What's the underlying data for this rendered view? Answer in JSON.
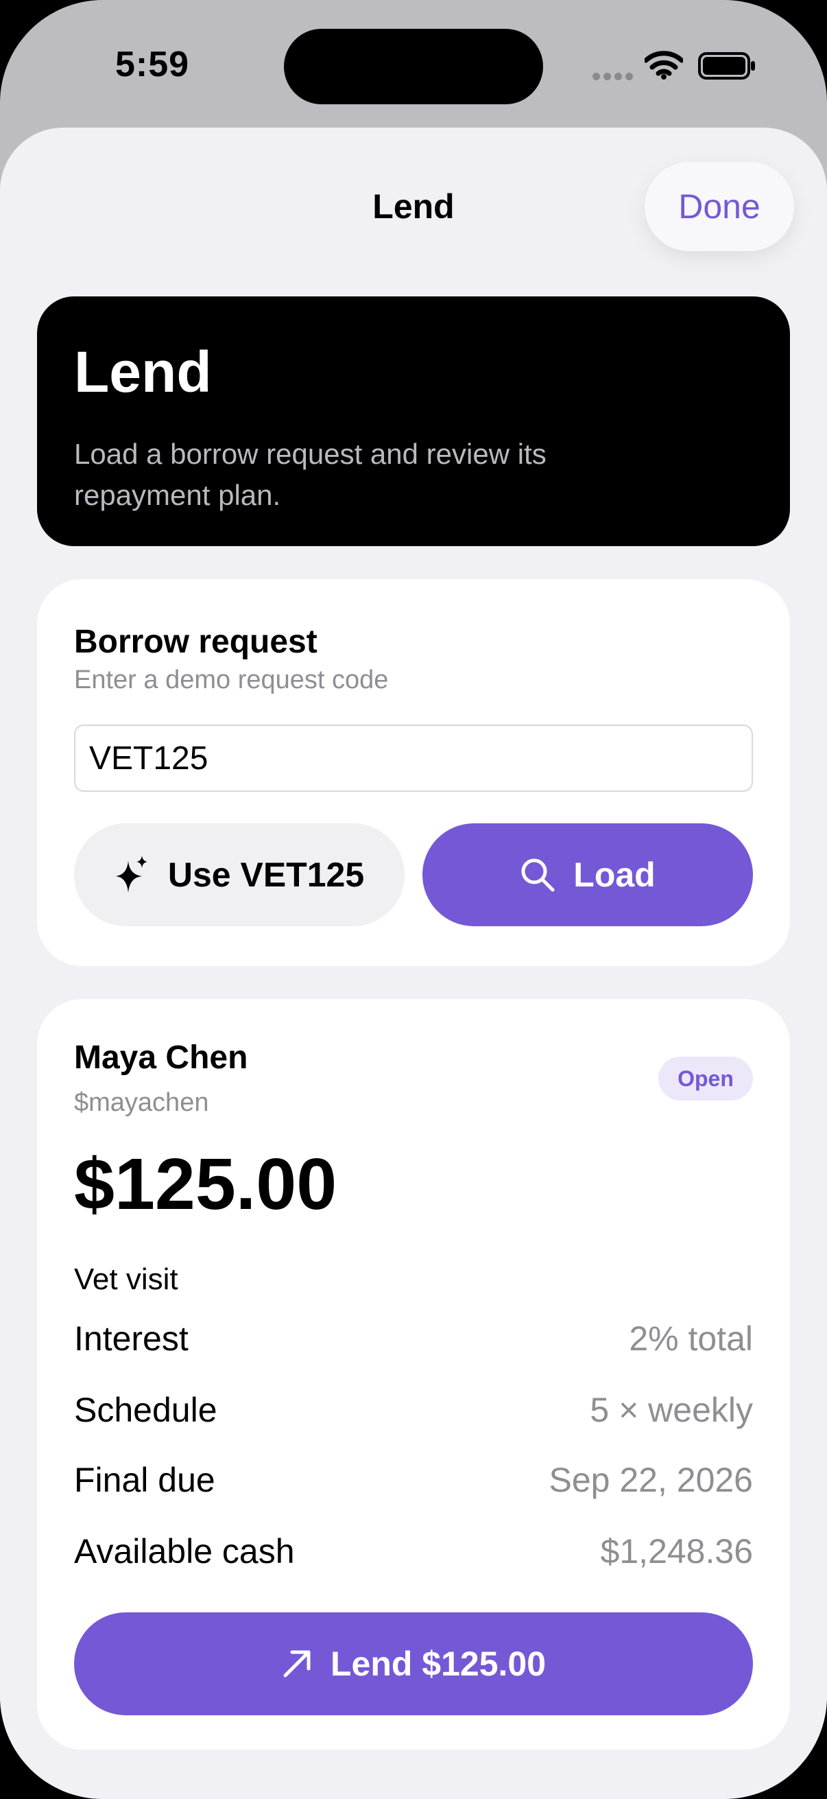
{
  "status_bar": {
    "time": "5:59"
  },
  "sheet": {
    "title": "Lend",
    "done_label": "Done"
  },
  "hero": {
    "title": "Lend",
    "subtitle": "Load a borrow request and review its repayment plan."
  },
  "request": {
    "title": "Borrow request",
    "subtitle": "Enter a demo request code",
    "code_value": "VET125",
    "use_demo_label": "Use VET125",
    "load_label": "Load"
  },
  "loan": {
    "name": "Maya Chen",
    "handle": "$mayachen",
    "status": "Open",
    "amount": "$125.00",
    "purpose": "Vet visit",
    "details": [
      {
        "label": "Interest",
        "value": "2% total"
      },
      {
        "label": "Schedule",
        "value": "5 × weekly"
      },
      {
        "label": "Final due",
        "value": "Sep 22, 2026"
      },
      {
        "label": "Available cash",
        "value": "$1,248.36"
      }
    ],
    "lend_label": "Lend $125.00"
  },
  "icons": {
    "sparkles": "sparkles-icon",
    "search": "search-icon",
    "arrow": "arrow-up-right-icon",
    "wifi": "wifi-icon",
    "battery": "battery-icon"
  },
  "colors": {
    "accent": "#7558d6",
    "accent_badge_bg": "#ece8fa",
    "sheet_bg": "#f1f0f5",
    "hero_bg": "#000000",
    "secondary_text": "#8e8e93"
  }
}
